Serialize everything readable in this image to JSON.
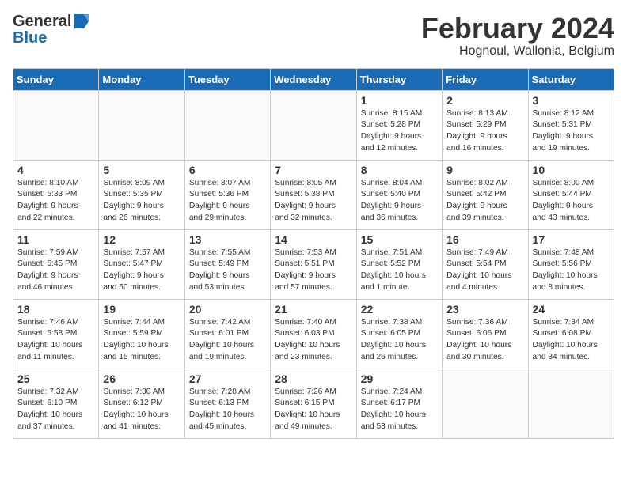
{
  "header": {
    "logo_general": "General",
    "logo_blue": "Blue",
    "month_year": "February 2024",
    "location": "Hognoul, Wallonia, Belgium"
  },
  "calendar": {
    "days_of_week": [
      "Sunday",
      "Monday",
      "Tuesday",
      "Wednesday",
      "Thursday",
      "Friday",
      "Saturday"
    ],
    "weeks": [
      [
        {
          "day": "",
          "info": ""
        },
        {
          "day": "",
          "info": ""
        },
        {
          "day": "",
          "info": ""
        },
        {
          "day": "",
          "info": ""
        },
        {
          "day": "1",
          "info": "Sunrise: 8:15 AM\nSunset: 5:28 PM\nDaylight: 9 hours\nand 12 minutes."
        },
        {
          "day": "2",
          "info": "Sunrise: 8:13 AM\nSunset: 5:29 PM\nDaylight: 9 hours\nand 16 minutes."
        },
        {
          "day": "3",
          "info": "Sunrise: 8:12 AM\nSunset: 5:31 PM\nDaylight: 9 hours\nand 19 minutes."
        }
      ],
      [
        {
          "day": "4",
          "info": "Sunrise: 8:10 AM\nSunset: 5:33 PM\nDaylight: 9 hours\nand 22 minutes."
        },
        {
          "day": "5",
          "info": "Sunrise: 8:09 AM\nSunset: 5:35 PM\nDaylight: 9 hours\nand 26 minutes."
        },
        {
          "day": "6",
          "info": "Sunrise: 8:07 AM\nSunset: 5:36 PM\nDaylight: 9 hours\nand 29 minutes."
        },
        {
          "day": "7",
          "info": "Sunrise: 8:05 AM\nSunset: 5:38 PM\nDaylight: 9 hours\nand 32 minutes."
        },
        {
          "day": "8",
          "info": "Sunrise: 8:04 AM\nSunset: 5:40 PM\nDaylight: 9 hours\nand 36 minutes."
        },
        {
          "day": "9",
          "info": "Sunrise: 8:02 AM\nSunset: 5:42 PM\nDaylight: 9 hours\nand 39 minutes."
        },
        {
          "day": "10",
          "info": "Sunrise: 8:00 AM\nSunset: 5:44 PM\nDaylight: 9 hours\nand 43 minutes."
        }
      ],
      [
        {
          "day": "11",
          "info": "Sunrise: 7:59 AM\nSunset: 5:45 PM\nDaylight: 9 hours\nand 46 minutes."
        },
        {
          "day": "12",
          "info": "Sunrise: 7:57 AM\nSunset: 5:47 PM\nDaylight: 9 hours\nand 50 minutes."
        },
        {
          "day": "13",
          "info": "Sunrise: 7:55 AM\nSunset: 5:49 PM\nDaylight: 9 hours\nand 53 minutes."
        },
        {
          "day": "14",
          "info": "Sunrise: 7:53 AM\nSunset: 5:51 PM\nDaylight: 9 hours\nand 57 minutes."
        },
        {
          "day": "15",
          "info": "Sunrise: 7:51 AM\nSunset: 5:52 PM\nDaylight: 10 hours\nand 1 minute."
        },
        {
          "day": "16",
          "info": "Sunrise: 7:49 AM\nSunset: 5:54 PM\nDaylight: 10 hours\nand 4 minutes."
        },
        {
          "day": "17",
          "info": "Sunrise: 7:48 AM\nSunset: 5:56 PM\nDaylight: 10 hours\nand 8 minutes."
        }
      ],
      [
        {
          "day": "18",
          "info": "Sunrise: 7:46 AM\nSunset: 5:58 PM\nDaylight: 10 hours\nand 11 minutes."
        },
        {
          "day": "19",
          "info": "Sunrise: 7:44 AM\nSunset: 5:59 PM\nDaylight: 10 hours\nand 15 minutes."
        },
        {
          "day": "20",
          "info": "Sunrise: 7:42 AM\nSunset: 6:01 PM\nDaylight: 10 hours\nand 19 minutes."
        },
        {
          "day": "21",
          "info": "Sunrise: 7:40 AM\nSunset: 6:03 PM\nDaylight: 10 hours\nand 23 minutes."
        },
        {
          "day": "22",
          "info": "Sunrise: 7:38 AM\nSunset: 6:05 PM\nDaylight: 10 hours\nand 26 minutes."
        },
        {
          "day": "23",
          "info": "Sunrise: 7:36 AM\nSunset: 6:06 PM\nDaylight: 10 hours\nand 30 minutes."
        },
        {
          "day": "24",
          "info": "Sunrise: 7:34 AM\nSunset: 6:08 PM\nDaylight: 10 hours\nand 34 minutes."
        }
      ],
      [
        {
          "day": "25",
          "info": "Sunrise: 7:32 AM\nSunset: 6:10 PM\nDaylight: 10 hours\nand 37 minutes."
        },
        {
          "day": "26",
          "info": "Sunrise: 7:30 AM\nSunset: 6:12 PM\nDaylight: 10 hours\nand 41 minutes."
        },
        {
          "day": "27",
          "info": "Sunrise: 7:28 AM\nSunset: 6:13 PM\nDaylight: 10 hours\nand 45 minutes."
        },
        {
          "day": "28",
          "info": "Sunrise: 7:26 AM\nSunset: 6:15 PM\nDaylight: 10 hours\nand 49 minutes."
        },
        {
          "day": "29",
          "info": "Sunrise: 7:24 AM\nSunset: 6:17 PM\nDaylight: 10 hours\nand 53 minutes."
        },
        {
          "day": "",
          "info": ""
        },
        {
          "day": "",
          "info": ""
        }
      ]
    ]
  }
}
